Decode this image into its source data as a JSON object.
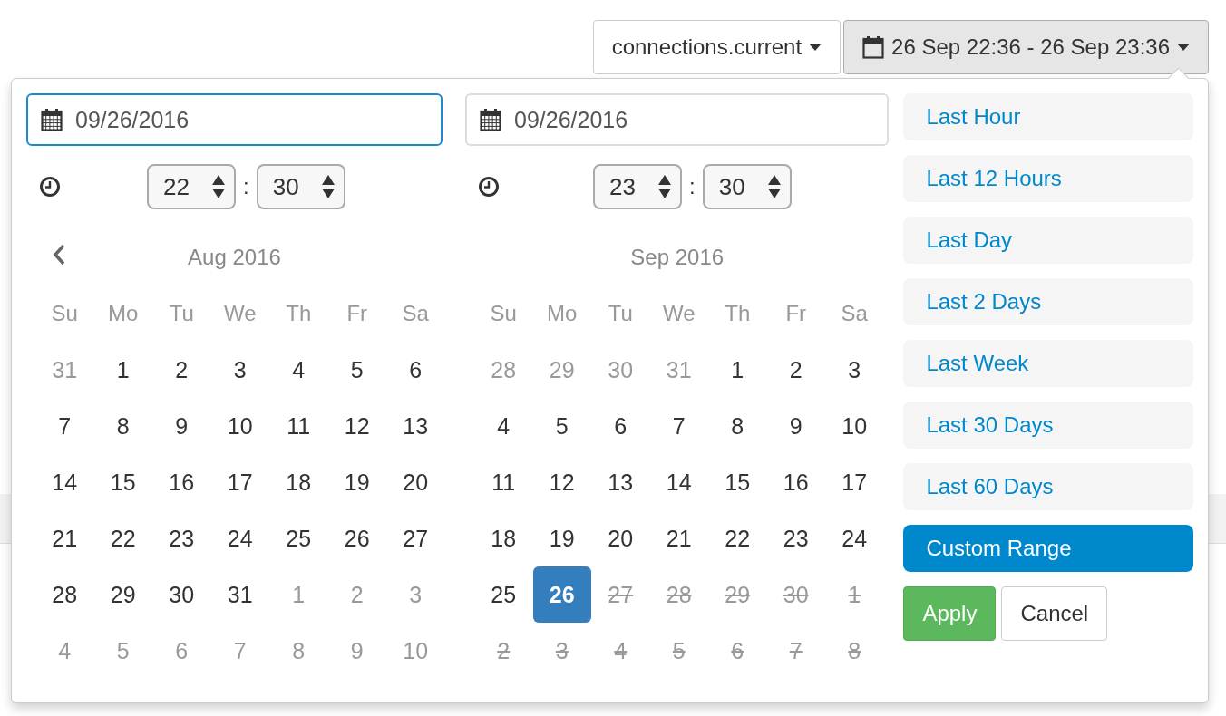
{
  "toolbar": {
    "metric_button": {
      "label": "connections.current"
    },
    "range_button": {
      "label": "26 Sep 22:36 - 26 Sep 23:36"
    }
  },
  "picker": {
    "start": {
      "date": "09/26/2016",
      "focused": true,
      "hour": "22",
      "minute": "30",
      "separator": ":"
    },
    "end": {
      "date": "09/26/2016",
      "focused": false,
      "hour": "23",
      "minute": "30",
      "separator": ":"
    },
    "calendars": [
      {
        "month": "Aug 2016",
        "prev": true,
        "weekdays": [
          "Su",
          "Mo",
          "Tu",
          "We",
          "Th",
          "Fr",
          "Sa"
        ],
        "days": [
          {
            "d": "31",
            "kind": "off",
            "selected": false
          },
          {
            "d": "1",
            "kind": "current",
            "selected": false
          },
          {
            "d": "2",
            "kind": "current",
            "selected": false
          },
          {
            "d": "3",
            "kind": "current",
            "selected": false
          },
          {
            "d": "4",
            "kind": "current",
            "selected": false
          },
          {
            "d": "5",
            "kind": "current",
            "selected": false
          },
          {
            "d": "6",
            "kind": "current",
            "selected": false
          },
          {
            "d": "7",
            "kind": "current",
            "selected": false
          },
          {
            "d": "8",
            "kind": "current",
            "selected": false
          },
          {
            "d": "9",
            "kind": "current",
            "selected": false
          },
          {
            "d": "10",
            "kind": "current",
            "selected": false
          },
          {
            "d": "11",
            "kind": "current",
            "selected": false
          },
          {
            "d": "12",
            "kind": "current",
            "selected": false
          },
          {
            "d": "13",
            "kind": "current",
            "selected": false
          },
          {
            "d": "14",
            "kind": "current",
            "selected": false
          },
          {
            "d": "15",
            "kind": "current",
            "selected": false
          },
          {
            "d": "16",
            "kind": "current",
            "selected": false
          },
          {
            "d": "17",
            "kind": "current",
            "selected": false
          },
          {
            "d": "18",
            "kind": "current",
            "selected": false
          },
          {
            "d": "19",
            "kind": "current",
            "selected": false
          },
          {
            "d": "20",
            "kind": "current",
            "selected": false
          },
          {
            "d": "21",
            "kind": "current",
            "selected": false
          },
          {
            "d": "22",
            "kind": "current",
            "selected": false
          },
          {
            "d": "23",
            "kind": "current",
            "selected": false
          },
          {
            "d": "24",
            "kind": "current",
            "selected": false
          },
          {
            "d": "25",
            "kind": "current",
            "selected": false
          },
          {
            "d": "26",
            "kind": "current",
            "selected": false
          },
          {
            "d": "27",
            "kind": "current",
            "selected": false
          },
          {
            "d": "28",
            "kind": "current",
            "selected": false
          },
          {
            "d": "29",
            "kind": "current",
            "selected": false
          },
          {
            "d": "30",
            "kind": "current",
            "selected": false
          },
          {
            "d": "31",
            "kind": "current",
            "selected": false
          },
          {
            "d": "1",
            "kind": "off",
            "selected": false
          },
          {
            "d": "2",
            "kind": "off",
            "selected": false
          },
          {
            "d": "3",
            "kind": "off",
            "selected": false
          },
          {
            "d": "4",
            "kind": "off",
            "selected": false
          },
          {
            "d": "5",
            "kind": "off",
            "selected": false
          },
          {
            "d": "6",
            "kind": "off",
            "selected": false
          },
          {
            "d": "7",
            "kind": "off",
            "selected": false
          },
          {
            "d": "8",
            "kind": "off",
            "selected": false
          },
          {
            "d": "9",
            "kind": "off",
            "selected": false
          },
          {
            "d": "10",
            "kind": "off",
            "selected": false
          }
        ]
      },
      {
        "month": "Sep 2016",
        "prev": false,
        "weekdays": [
          "Su",
          "Mo",
          "Tu",
          "We",
          "Th",
          "Fr",
          "Sa"
        ],
        "days": [
          {
            "d": "28",
            "kind": "off",
            "selected": false
          },
          {
            "d": "29",
            "kind": "off",
            "selected": false
          },
          {
            "d": "30",
            "kind": "off",
            "selected": false
          },
          {
            "d": "31",
            "kind": "off",
            "selected": false
          },
          {
            "d": "1",
            "kind": "current",
            "selected": false
          },
          {
            "d": "2",
            "kind": "current",
            "selected": false
          },
          {
            "d": "3",
            "kind": "current",
            "selected": false
          },
          {
            "d": "4",
            "kind": "current",
            "selected": false
          },
          {
            "d": "5",
            "kind": "current",
            "selected": false
          },
          {
            "d": "6",
            "kind": "current",
            "selected": false
          },
          {
            "d": "7",
            "kind": "current",
            "selected": false
          },
          {
            "d": "8",
            "kind": "current",
            "selected": false
          },
          {
            "d": "9",
            "kind": "current",
            "selected": false
          },
          {
            "d": "10",
            "kind": "current",
            "selected": false
          },
          {
            "d": "11",
            "kind": "current",
            "selected": false
          },
          {
            "d": "12",
            "kind": "current",
            "selected": false
          },
          {
            "d": "13",
            "kind": "current",
            "selected": false
          },
          {
            "d": "14",
            "kind": "current",
            "selected": false
          },
          {
            "d": "15",
            "kind": "current",
            "selected": false
          },
          {
            "d": "16",
            "kind": "current",
            "selected": false
          },
          {
            "d": "17",
            "kind": "current",
            "selected": false
          },
          {
            "d": "18",
            "kind": "current",
            "selected": false
          },
          {
            "d": "19",
            "kind": "current",
            "selected": false
          },
          {
            "d": "20",
            "kind": "current",
            "selected": false
          },
          {
            "d": "21",
            "kind": "current",
            "selected": false
          },
          {
            "d": "22",
            "kind": "current",
            "selected": false
          },
          {
            "d": "23",
            "kind": "current",
            "selected": false
          },
          {
            "d": "24",
            "kind": "current",
            "selected": false
          },
          {
            "d": "25",
            "kind": "current",
            "selected": false
          },
          {
            "d": "26",
            "kind": "current",
            "selected": true
          },
          {
            "d": "27",
            "kind": "disabled",
            "selected": false
          },
          {
            "d": "28",
            "kind": "disabled",
            "selected": false
          },
          {
            "d": "29",
            "kind": "disabled",
            "selected": false
          },
          {
            "d": "30",
            "kind": "disabled",
            "selected": false
          },
          {
            "d": "1",
            "kind": "disabled",
            "selected": false
          },
          {
            "d": "2",
            "kind": "disabled",
            "selected": false
          },
          {
            "d": "3",
            "kind": "disabled",
            "selected": false
          },
          {
            "d": "4",
            "kind": "disabled",
            "selected": false
          },
          {
            "d": "5",
            "kind": "disabled",
            "selected": false
          },
          {
            "d": "6",
            "kind": "disabled",
            "selected": false
          },
          {
            "d": "7",
            "kind": "disabled",
            "selected": false
          },
          {
            "d": "8",
            "kind": "disabled",
            "selected": false
          }
        ]
      }
    ],
    "ranges": [
      {
        "label": "Last Hour",
        "selected": false
      },
      {
        "label": "Last 12 Hours",
        "selected": false
      },
      {
        "label": "Last Day",
        "selected": false
      },
      {
        "label": "Last 2 Days",
        "selected": false
      },
      {
        "label": "Last Week",
        "selected": false
      },
      {
        "label": "Last 30 Days",
        "selected": false
      },
      {
        "label": "Last 60 Days",
        "selected": false
      },
      {
        "label": "Custom Range",
        "selected": true
      }
    ],
    "apply_button": {
      "label": "Apply"
    },
    "cancel_button": {
      "label": "Cancel"
    }
  }
}
